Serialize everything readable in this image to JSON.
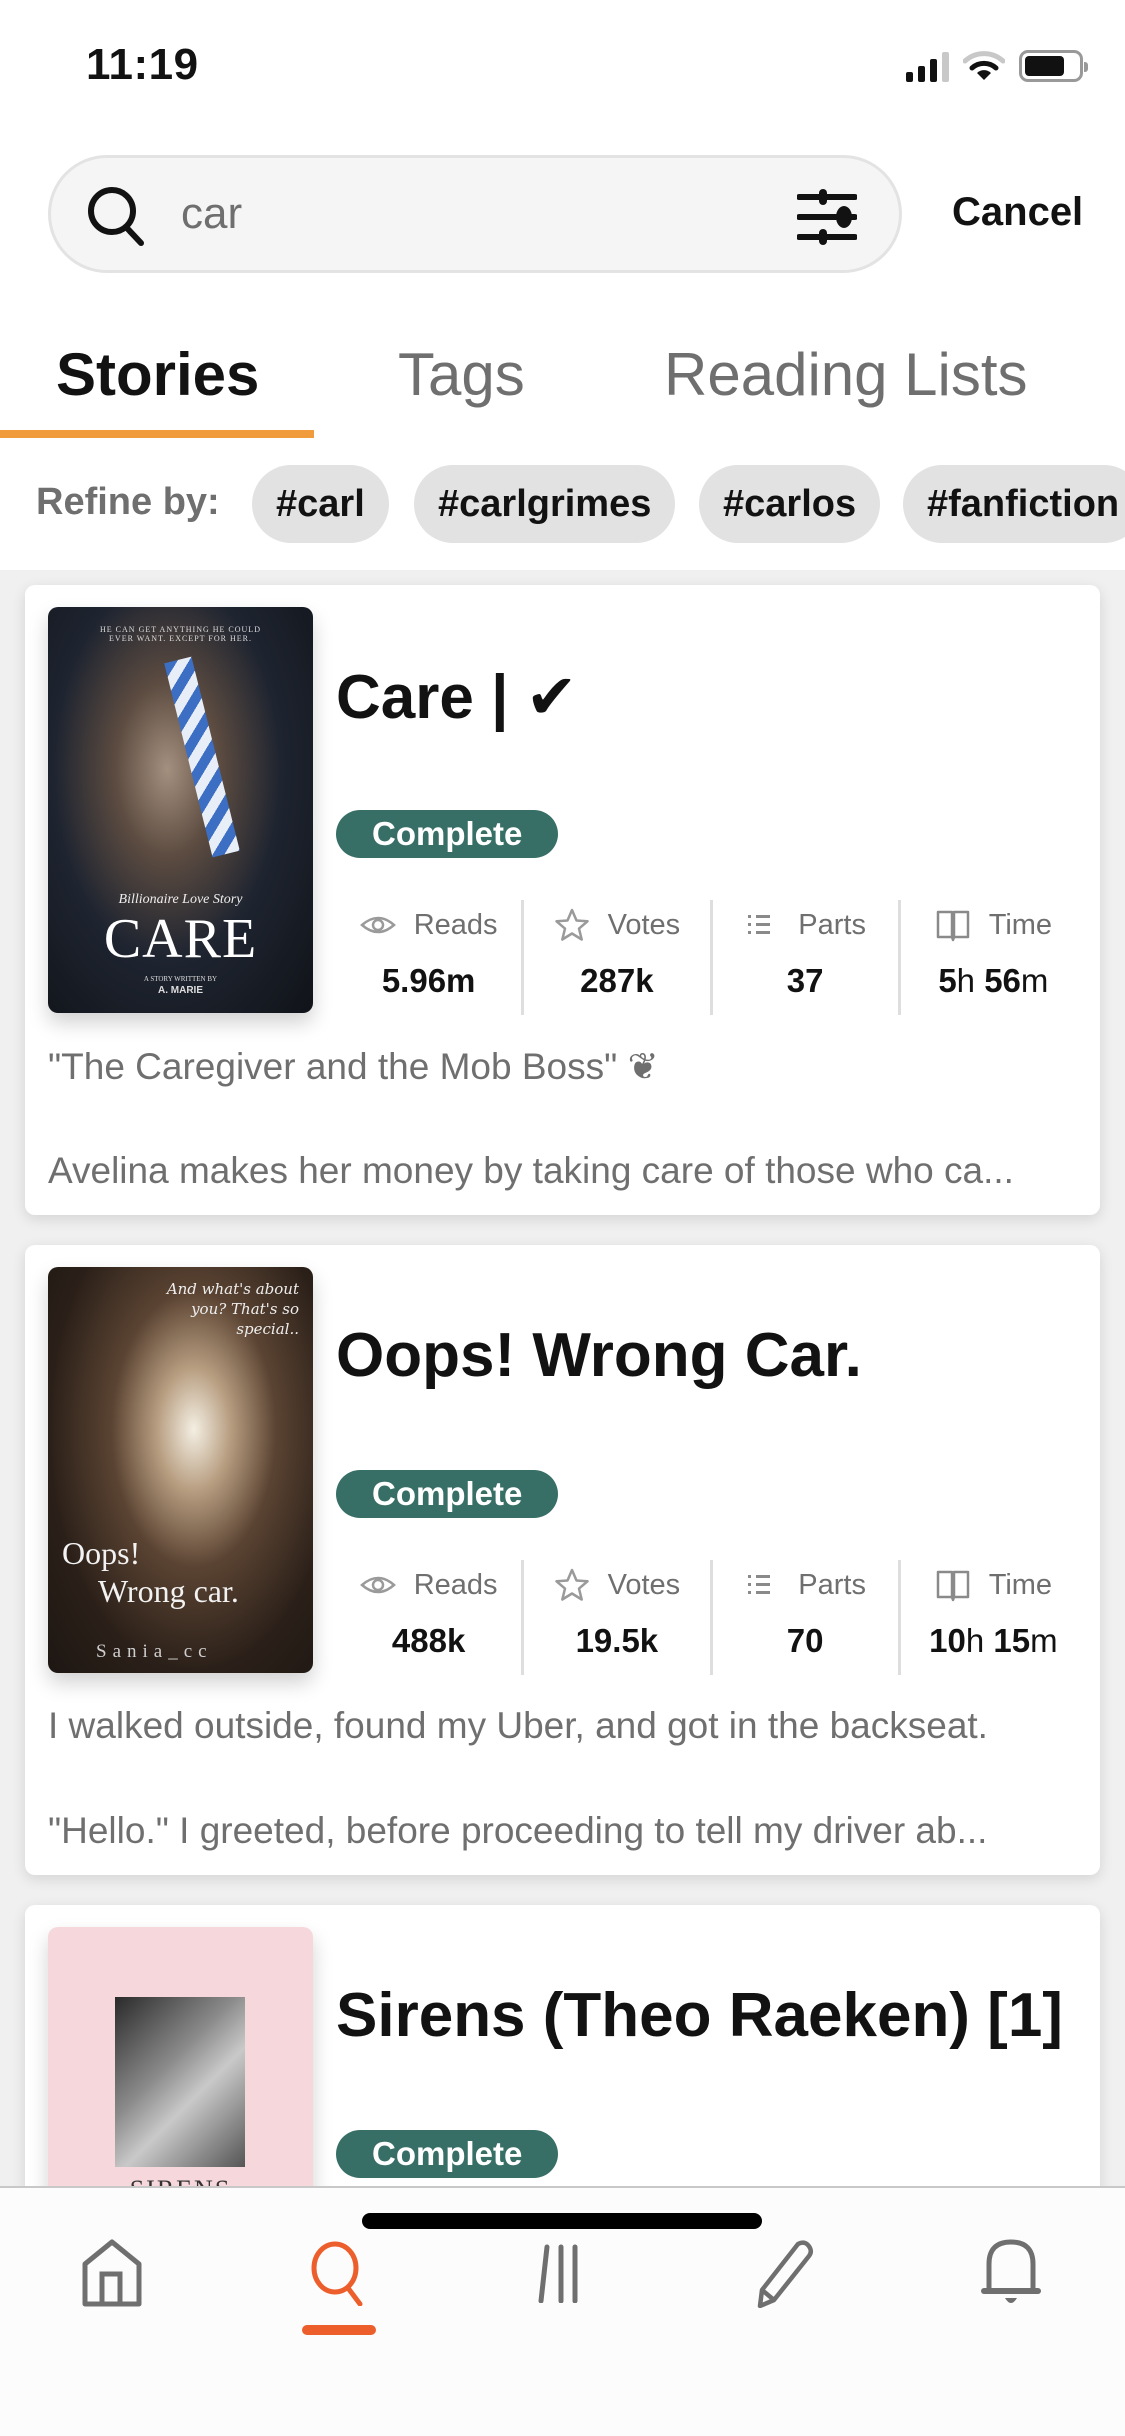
{
  "status_bar": {
    "time": "11:19"
  },
  "search": {
    "value": "car",
    "cancel_label": "Cancel"
  },
  "tabs": [
    {
      "label": "Stories",
      "active": true
    },
    {
      "label": "Tags",
      "active": false
    },
    {
      "label": "Reading Lists",
      "active": false
    }
  ],
  "refine": {
    "label": "Refine by:",
    "chips": [
      "#carl",
      "#carlgrimes",
      "#carlos",
      "#fanfiction"
    ]
  },
  "stat_labels": {
    "reads": "Reads",
    "votes": "Votes",
    "parts": "Parts",
    "time": "Time"
  },
  "stories": [
    {
      "title": "Care | ✔",
      "status": "Complete",
      "cover": {
        "top_text": "HE CAN GET ANYTHING HE COULD EVER WANT. EXCEPT FOR HER.",
        "subtitle": "Billionaire Love Story",
        "title": "CARE",
        "byline": "A STORY WRITTEN BY",
        "author": "A. MARIE"
      },
      "reads": "5.96m",
      "votes": "287k",
      "parts": "37",
      "time": {
        "h": "5",
        "m": "56"
      },
      "description_line1": "\"The Caregiver and the Mob Boss\" ❦",
      "description_line2": "Avelina makes her money by taking care of those who ca..."
    },
    {
      "title": "Oops! Wrong Car.",
      "status": "Complete",
      "cover": {
        "top_text": "And what's about you? That's so special..",
        "title_1": "Oops!",
        "title_2": "Wrong car.",
        "author": "Sania_cc"
      },
      "reads": "488k",
      "votes": "19.5k",
      "parts": "70",
      "time": {
        "h": "10",
        "m": "15"
      },
      "description_line1": "I walked outside, found my Uber, and got in the backseat.",
      "description_line2": "\"Hello.\" I greeted, before proceeding to tell my driver ab..."
    },
    {
      "title": "Sirens (Theo Raeken) [1]",
      "status": "Complete",
      "cover": {
        "title": "SIRENS"
      }
    }
  ],
  "time_units": {
    "h": "h",
    "m": "m"
  },
  "bottom_nav": [
    {
      "name": "home",
      "active": false
    },
    {
      "name": "search",
      "active": true
    },
    {
      "name": "library",
      "active": false
    },
    {
      "name": "write",
      "active": false
    },
    {
      "name": "notifications",
      "active": false
    }
  ],
  "colors": {
    "accent_tab": "#f09b3c",
    "accent_nav": "#ec5f2c",
    "badge_complete": "#376f66"
  }
}
